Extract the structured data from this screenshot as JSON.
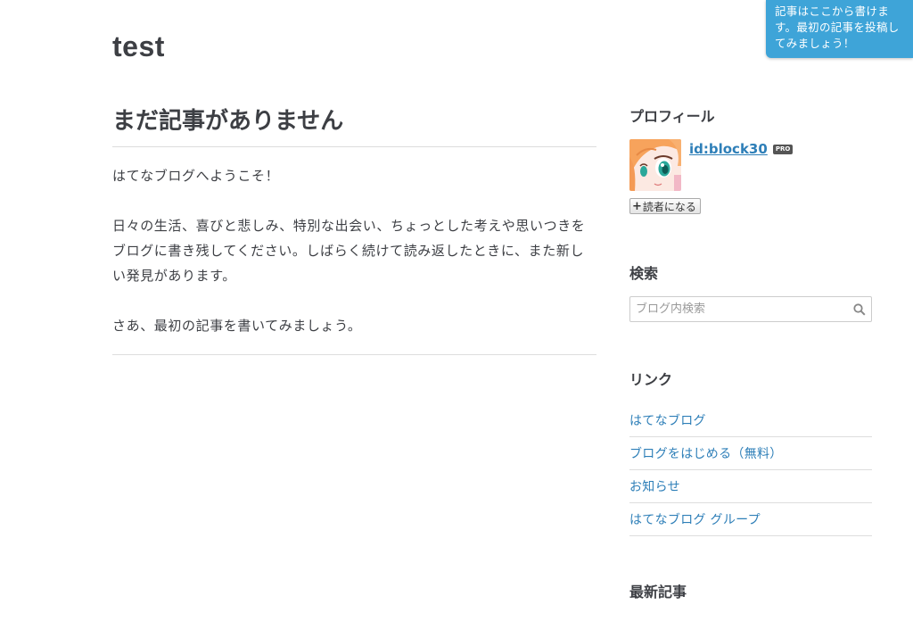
{
  "blog": {
    "title": "test"
  },
  "entry": {
    "title": "まだ記事がありません",
    "paragraphs": [
      "はてなブログへようこそ！",
      "日々の生活、喜びと悲しみ、特別な出会い、ちょっとした考えや思いつきをブログに書き残してください。しばらく続けて読み返したときに、また新しい発見があります。",
      "さあ、最初の記事を書いてみましょう。"
    ]
  },
  "sidebar": {
    "profile": {
      "title": "プロフィール",
      "user_id": "id:block30",
      "badge": "PRO",
      "subscribe_label": "読者になる"
    },
    "search": {
      "title": "検索",
      "placeholder": "ブログ内検索",
      "icon": "search-icon"
    },
    "links": {
      "title": "リンク",
      "items": [
        "はてなブログ",
        "ブログをはじめる（無料）",
        "お知らせ",
        "はてなブログ グループ"
      ]
    },
    "recent": {
      "title": "最新記事"
    }
  },
  "tooltip": {
    "text": "記事はここから書けます。最初の記事を投稿してみましょう！"
  },
  "colors": {
    "link": "#2e7fb8",
    "tooltip_bg": "#3ea4d8",
    "text": "#3d3f44"
  }
}
